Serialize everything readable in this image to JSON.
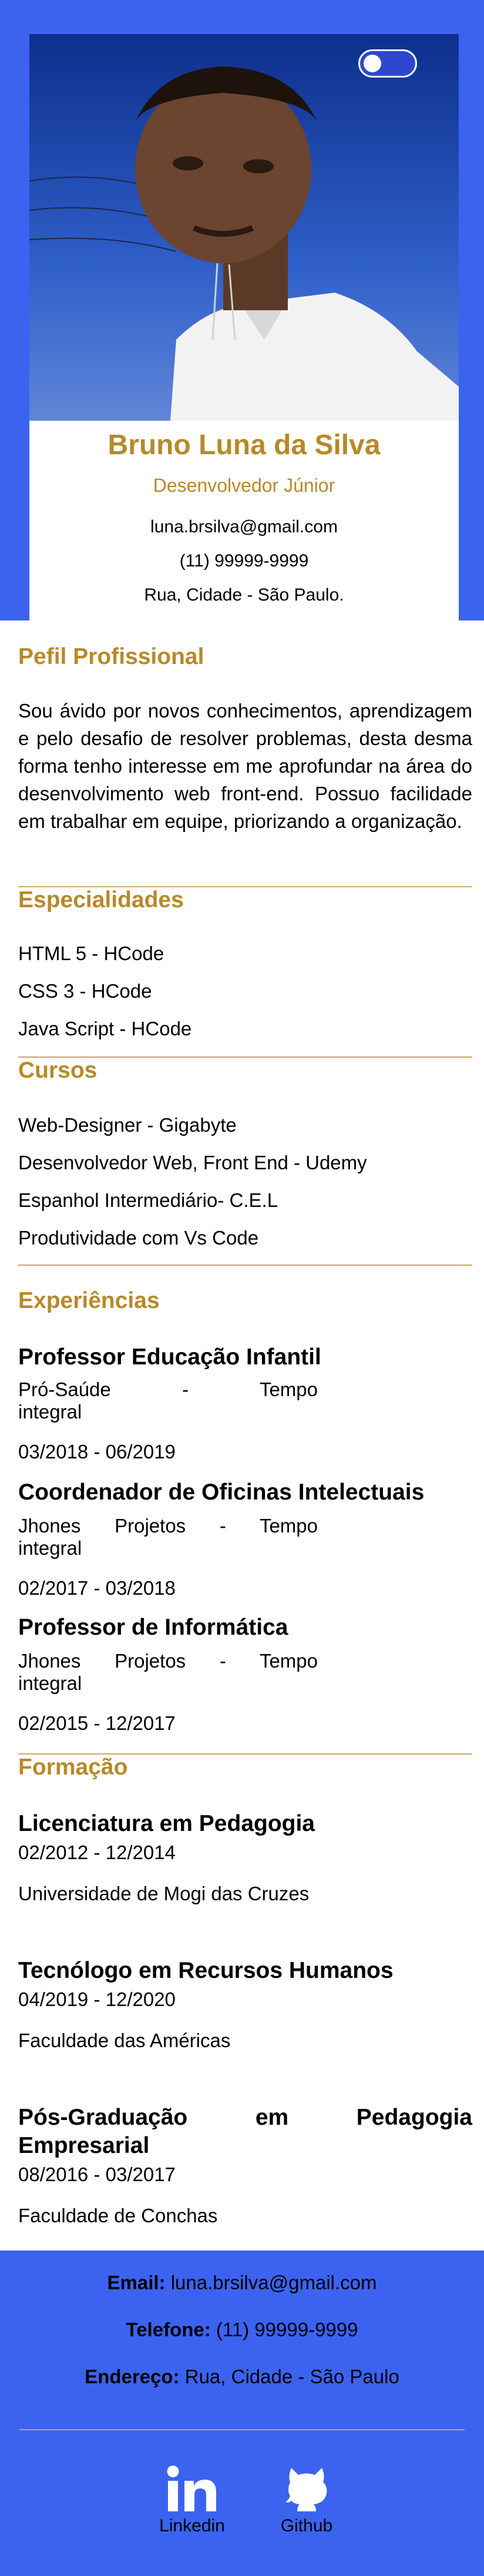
{
  "theme": {
    "accent": "#b8892a",
    "primary": "#3b63f0"
  },
  "header": {
    "toggle_state": "off",
    "name": "Bruno Luna da Silva",
    "role": "Desenvolvedor Júnior",
    "email": "luna.brsilva@gmail.com",
    "phone": "(11) 99999-9999",
    "address": "Rua, Cidade - São Paulo."
  },
  "profile": {
    "title": "Pefil Profissional",
    "text": "Sou ávido por novos conhecimentos, aprendizagem e pelo desafio de resolver problemas, desta desma forma tenho interesse em me aprofundar na área do desenvolvimento web front-end. Possuo facilidade em trabalhar em equipe, priorizando a organização."
  },
  "skills": {
    "title": "Especialidades",
    "items": [
      "HTML 5 - HCode",
      "CSS 3 - HCode",
      "Java Script - HCode"
    ]
  },
  "courses": {
    "title": "Cursos",
    "items": [
      "Web-Designer - Gigabyte",
      "Desenvolvedor Web, Front End - Udemy",
      "Espanhol Intermediário- C.E.L",
      "Produtividade com Vs Code"
    ]
  },
  "experience": {
    "title": "Experiências",
    "items": [
      {
        "role": "Professor Educação Infantil",
        "place_line1": "Pró-Saúde - Tempo",
        "place_line2": "integral",
        "period": "03/2018 - 06/2019"
      },
      {
        "role": "Coordenador de Oficinas Intelectuais",
        "place_line1": "Jhones Projetos - Tempo",
        "place_line2": "integral",
        "period": "02/2017 - 03/2018"
      },
      {
        "role": "Professor de Informática",
        "place_line1": "Jhones Projetos - Tempo",
        "place_line2": "integral",
        "period": "02/2015 - 12/2017"
      }
    ]
  },
  "education": {
    "title": "Formação",
    "items": [
      {
        "course": "Licenciatura em Pedagogia",
        "period": "02/2012 - 12/2014",
        "school": "Universidade de Mogi das Cruzes"
      },
      {
        "course": "Tecnólogo em Recursos Humanos",
        "period": "04/2019 - 12/2020",
        "school": "Faculdade das Américas"
      },
      {
        "course_line1": "Pós-Graduação em Pedagogia",
        "course_line2": "Empresarial",
        "period": "08/2016 - 03/2017",
        "school": "Faculdade de Conchas"
      }
    ]
  },
  "footer": {
    "email_label": "Email:",
    "email": "luna.brsilva@gmail.com",
    "phone_label": "Telefone:",
    "phone": "(11) 99999-9999",
    "address_label": "Endereço:",
    "address": "Rua, Cidade - São Paulo",
    "social": [
      {
        "label": "Linkedin",
        "icon": "linkedin-icon"
      },
      {
        "label": "Github",
        "icon": "github-icon"
      }
    ]
  }
}
